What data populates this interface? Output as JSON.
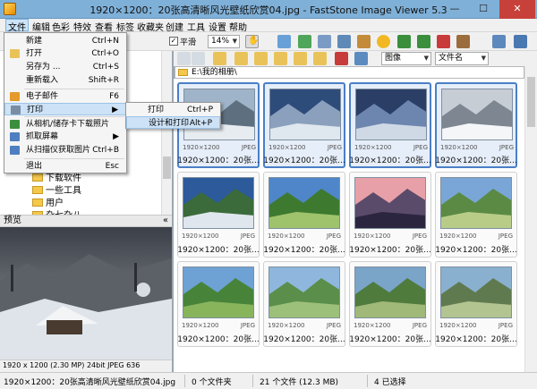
{
  "window": {
    "title": "1920×1200：20张高清晰风光壁纸欣赏04.jpg - FastStone Image Viewer 5.3",
    "minimize": "—",
    "maximize": "☐",
    "close": "✕"
  },
  "menubar": [
    "文件",
    "编辑",
    "色彩",
    "特效",
    "查看",
    "标签",
    "收藏夹",
    "创建",
    "工具",
    "设置",
    "帮助"
  ],
  "toolbar": {
    "smooth_label": "平滑",
    "zoom": "14%",
    "filter": "图像",
    "sort": "文件名"
  },
  "file_menu": [
    {
      "label": "新建",
      "shortcut": "Ctrl+N"
    },
    {
      "label": "打开",
      "shortcut": "Ctrl+O"
    },
    {
      "label": "另存为 ...",
      "shortcut": "Ctrl+S"
    },
    {
      "label": "重新载入",
      "shortcut": "Shift+R"
    },
    {
      "label": "电子邮件",
      "shortcut": "F6"
    },
    {
      "label": "打印",
      "shortcut": "▶"
    },
    {
      "label": "从相机/储存卡下载照片",
      "shortcut": ""
    },
    {
      "label": "抓取屏幕",
      "shortcut": "▶"
    },
    {
      "label": "从扫描仪获取图片",
      "shortcut": "Ctrl+B"
    },
    {
      "label": "退出",
      "shortcut": "Esc"
    }
  ],
  "print_submenu": [
    {
      "label": "打印",
      "shortcut": "Ctrl+P"
    },
    {
      "label": "设计和打印",
      "shortcut": "Alt+P"
    }
  ],
  "tree": [
    "下载软件",
    "一些工具",
    "用户",
    "杂七杂八"
  ],
  "preview": {
    "header": "预览",
    "collapse": "«",
    "info": "1920 x 1200 (2.30 MP)  24bit  JPEG  636"
  },
  "address": "E:\\我的相册\\",
  "thumbnails": {
    "size": "1920×1200",
    "format": "JPEG",
    "caption": "1920×1200：20张...",
    "count": 12
  },
  "status": {
    "filename": "1920×1200：20张高清晰风光壁纸欣赏04.jpg",
    "folders": "0 个文件夹",
    "files": "21 个文件 (12.3 MB)",
    "selected": "4 已选择"
  }
}
